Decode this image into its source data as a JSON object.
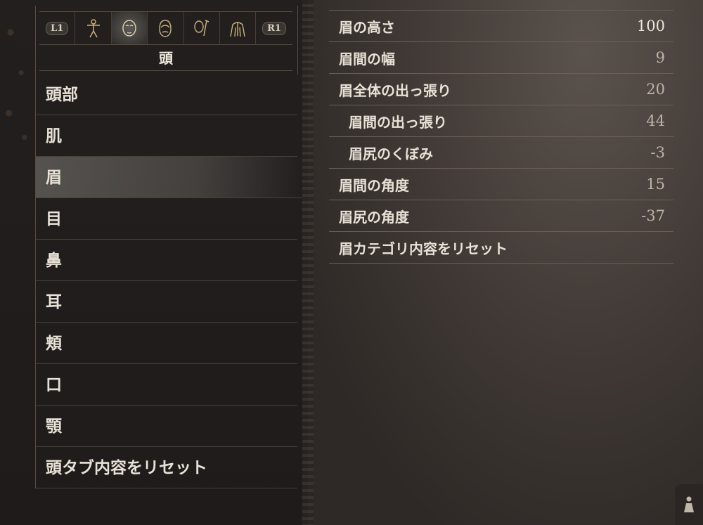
{
  "tabs": {
    "left_button": "L1",
    "right_button": "R1",
    "icons": [
      "body-figure-icon",
      "face-icon",
      "hair-icon",
      "brush-icon",
      "torso-icon"
    ],
    "active_index": 1
  },
  "category_title": "頭",
  "menu": {
    "items": [
      "頭部",
      "肌",
      "眉",
      "目",
      "鼻",
      "耳",
      "頬",
      "口",
      "顎",
      "頭タブ内容をリセット"
    ],
    "selected_index": 2
  },
  "params": [
    {
      "label": "眉の高さ",
      "value": "100",
      "indent": false
    },
    {
      "label": "眉間の幅",
      "value": "9",
      "indent": false
    },
    {
      "label": "眉全体の出っ張り",
      "value": "20",
      "indent": false
    },
    {
      "label": "眉間の出っ張り",
      "value": "44",
      "indent": true
    },
    {
      "label": "眉尻のくぼみ",
      "value": "-3",
      "indent": true
    },
    {
      "label": "眉間の角度",
      "value": "15",
      "indent": false
    },
    {
      "label": "眉尻の角度",
      "value": "-37",
      "indent": false
    },
    {
      "label": "眉カテゴリ内容をリセット",
      "value": "",
      "indent": false
    }
  ],
  "colors": {
    "accent_gold": "#c9b27a",
    "frame_brown": "#5b4a3b"
  }
}
